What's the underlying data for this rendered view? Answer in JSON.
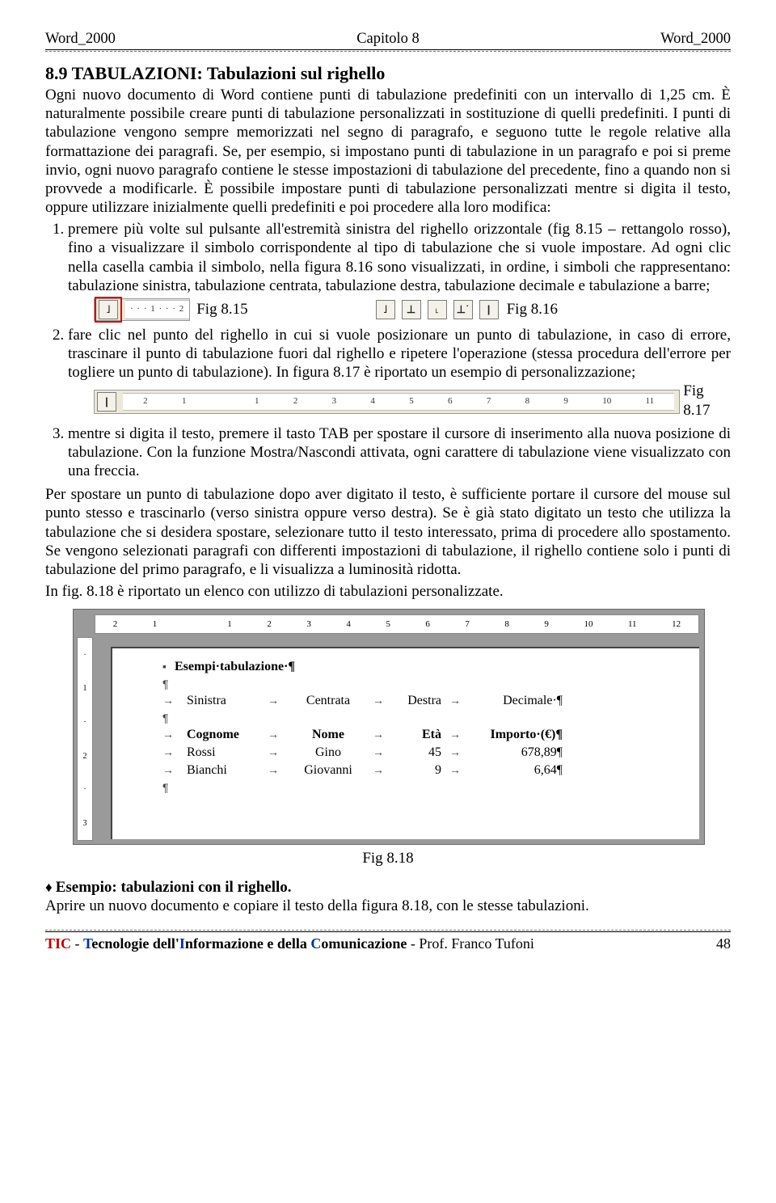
{
  "header": {
    "left": "Word_2000",
    "center": "Capitolo 8",
    "right": "Word_2000"
  },
  "section": {
    "title": "8.9 TABULAZIONI: Tabulazioni sul righello",
    "p1": "Ogni nuovo documento di Word contiene punti di tabulazione predefiniti con un intervallo di 1,25 cm. È naturalmente possibile creare punti di tabulazione personalizzati in sostituzione di quelli predefiniti. I punti di tabulazione vengono sempre memorizzati nel segno di paragrafo, e seguono tutte le regole relative alla formattazione dei paragrafi. Se, per esempio, si impostano punti di tabulazione in un paragrafo e poi si preme invio, ogni nuovo paragrafo contiene le stesse impostazioni di tabulazione del precedente, fino a quando non si provvede a modificarle. È possibile impostare punti di tabulazione personalizzati mentre si digita il testo, oppure utilizzare inizialmente quelli predefiniti e poi procedere alla loro modifica:"
  },
  "list": {
    "item1a": "premere più volte sul pulsante all'estremità sinistra del righello orizzontale (fig 8.15 – rettangolo rosso), fino a visualizzare il simbolo corrispondente al tipo di tabulazione che si vuole impostare. Ad ogni clic nella casella cambia il simbolo, nella figura 8.16 sono visualizzati, in ordine, i simboli che rappresentano: tabulazione sinistra, tabulazione centrata, tabulazione destra, tabulazione decimale e tabulazione a barre;",
    "fig815": "Fig 8.15",
    "fig816": "Fig 8.16",
    "item2": "fare clic nel punto del righello in cui si vuole posizionare un punto di tabulazione, in caso di errore, trascinare il punto di tabulazione fuori dal righello e ripetere l'operazione (stessa procedura dell'errore per togliere un punto di tabulazione). In figura 8.17 è riportato un esempio di personalizzazione;",
    "fig817": "Fig 8.17",
    "item3": "mentre si digita il testo, premere il tasto TAB per spostare il cursore di inserimento alla nuova posizione di tabulazione. Con la funzione Mostra/Nascondi attivata, ogni carattere di tabulazione viene visualizzato con una freccia."
  },
  "p2": "Per spostare un punto di tabulazione dopo aver digitato il testo, è sufficiente portare il cursore del mouse sul punto stesso e trascinarlo (verso sinistra oppure verso destra). Se è già stato digitato un testo che utilizza la tabulazione che si desidera spostare, selezionare tutto il testo interessato, prima di procedere allo spostamento. Se vengono selezionati paragrafi con differenti impostazioni di tabulazione, il righello contiene solo i punti di tabulazione del primo paragrafo, e li visualizza a luminosità ridotta.",
  "p3": "In fig. 8.18 è riportato un elenco con utilizzo di tabulazioni personalizzate.",
  "fig818_caption": "Fig 8.18",
  "screenshot": {
    "top_ruler": [
      "2",
      "1",
      "",
      "1",
      "2",
      "3",
      "4",
      "5",
      "6",
      "7",
      "8",
      "9",
      "10",
      "11",
      "12"
    ],
    "left_ruler": [
      "·",
      "1",
      "·",
      "2",
      "·",
      "3"
    ],
    "title_line": "Esempi·tabulazione·¶",
    "headers_row1": {
      "c1": "Sinistra",
      "c2": "Centrata",
      "c3": "Destra",
      "c4": "Decimale·¶"
    },
    "headers_row2": {
      "c1": "Cognome",
      "c2": "Nome",
      "c3": "Età",
      "c4": "Importo·(€)¶"
    },
    "data_row1": {
      "c1": "Rossi",
      "c2": "Gino",
      "c3": "45",
      "c4": "678,89¶"
    },
    "data_row2": {
      "c1": "Bianchi",
      "c2": "Giovanni",
      "c3": "9",
      "c4": "6,64¶"
    }
  },
  "example": {
    "title": "Esempio: tabulazioni con il righello.",
    "body": "Aprire un nuovo documento e copiare il testo della figura 8.18, con le stesse tabulazioni."
  },
  "tab_icons": {
    "left": "˩",
    "center": "⊥",
    "right": "˪",
    "decimal": "⊥˙",
    "bar": "|"
  },
  "ruler815_scale": "· · · 1 · · · 2",
  "ruler817_scale": [
    "2",
    "1",
    "",
    "1",
    "2",
    "3",
    "4",
    "5",
    "6",
    "7",
    "8",
    "9",
    "10",
    "11"
  ],
  "footer": {
    "tic": "TIC",
    "dash": " - ",
    "t": "T",
    "ecnologie": "ecnologie dell'",
    "i": "I",
    "nf": "nformazione e della ",
    "c": "C",
    "om": "omunicazione",
    "sep": "   -   ",
    "prof": "Prof. Franco Tufoni",
    "page": "48"
  }
}
